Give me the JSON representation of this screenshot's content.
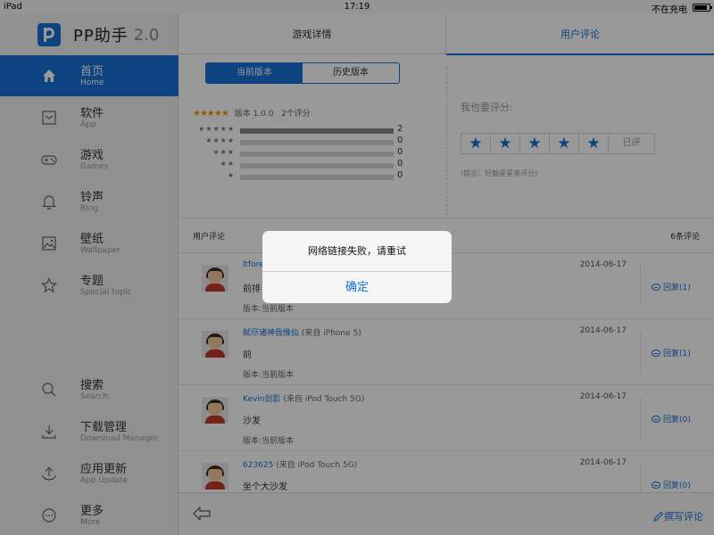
{
  "status_bar": {
    "device": "iPad",
    "time": "17:19",
    "charging": "不在充电",
    "battery_level": 0.9
  },
  "sidebar": {
    "logo": "PP助手",
    "version": "2.0",
    "items": [
      {
        "label": "首页",
        "sub": "Home",
        "icon": "home-icon",
        "active": true
      },
      {
        "label": "软件",
        "sub": "App",
        "icon": "app-icon",
        "active": false
      },
      {
        "label": "游戏",
        "sub": "Games",
        "icon": "gamepad-icon",
        "active": false
      },
      {
        "label": "铃声",
        "sub": "Ring",
        "icon": "bell-icon",
        "active": false
      },
      {
        "label": "壁纸",
        "sub": "Wallpaper",
        "icon": "image-icon",
        "active": false
      },
      {
        "label": "专题",
        "sub": "Special topic",
        "icon": "star-icon",
        "active": false
      },
      {
        "label": "搜索",
        "sub": "Search",
        "icon": "search-icon",
        "active": false
      },
      {
        "label": "下载管理",
        "sub": "Download Manager",
        "icon": "download-icon",
        "active": false
      },
      {
        "label": "应用更新",
        "sub": "App Update",
        "icon": "upload-icon",
        "active": false
      },
      {
        "label": "更多",
        "sub": "More",
        "icon": "more-icon",
        "active": false
      }
    ]
  },
  "tabs": {
    "detail": "游戏详情",
    "review": "用户评论",
    "active": "review"
  },
  "version_segment": {
    "current": "当前版本",
    "history": "历史版本",
    "active": "current"
  },
  "rating": {
    "stars": "★★★★★",
    "version_label": "版本 1.0.0",
    "count_label": "2个评分",
    "distribution": [
      {
        "stars": "★★★★★",
        "count": "2",
        "fraction": 1.0
      },
      {
        "stars": "★★★★",
        "count": "0",
        "fraction": 0
      },
      {
        "stars": "★★★",
        "count": "0",
        "fraction": 0
      },
      {
        "stars": "★★",
        "count": "0",
        "fraction": 0
      },
      {
        "stars": "★",
        "count": "0",
        "fraction": 0
      }
    ]
  },
  "my_rating": {
    "title": "我也要评分:",
    "star_glyph": "★",
    "star_count": 5,
    "rated_label": "已评",
    "hint": "(提示：轻触星星来评分)"
  },
  "reviews": {
    "title": "用户评论",
    "count": "6条评论",
    "items": [
      {
        "user": "ltforev",
        "device": "",
        "date": "2014-06-17",
        "text": "前排",
        "version": "版本:当前版本",
        "reply": "回复(1)"
      },
      {
        "user": "弑尽诸神我惟仙",
        "device": "(来自 iPhone 5)",
        "date": "2014-06-17",
        "text": "前",
        "version": "版本:当前版本",
        "reply": "回复(1)"
      },
      {
        "user": "Kevin剑影",
        "device": "(来自 iPod Touch 5G)",
        "date": "2014-06-17",
        "text": "沙发",
        "version": "版本:当前版本",
        "reply": "回复(0)"
      },
      {
        "user": "623625",
        "device": "(来自 iPod Touch 5G)",
        "date": "2014-06-17",
        "text": "坐个大沙发",
        "version": "",
        "reply": "回复(0)"
      }
    ]
  },
  "bottom_bar": {
    "write_label": "撰写评论"
  },
  "modal": {
    "message": "网络链接失败，请重试",
    "confirm": "确定"
  },
  "colors": {
    "accent": "#1570d6",
    "star_orange": "#f39800"
  }
}
